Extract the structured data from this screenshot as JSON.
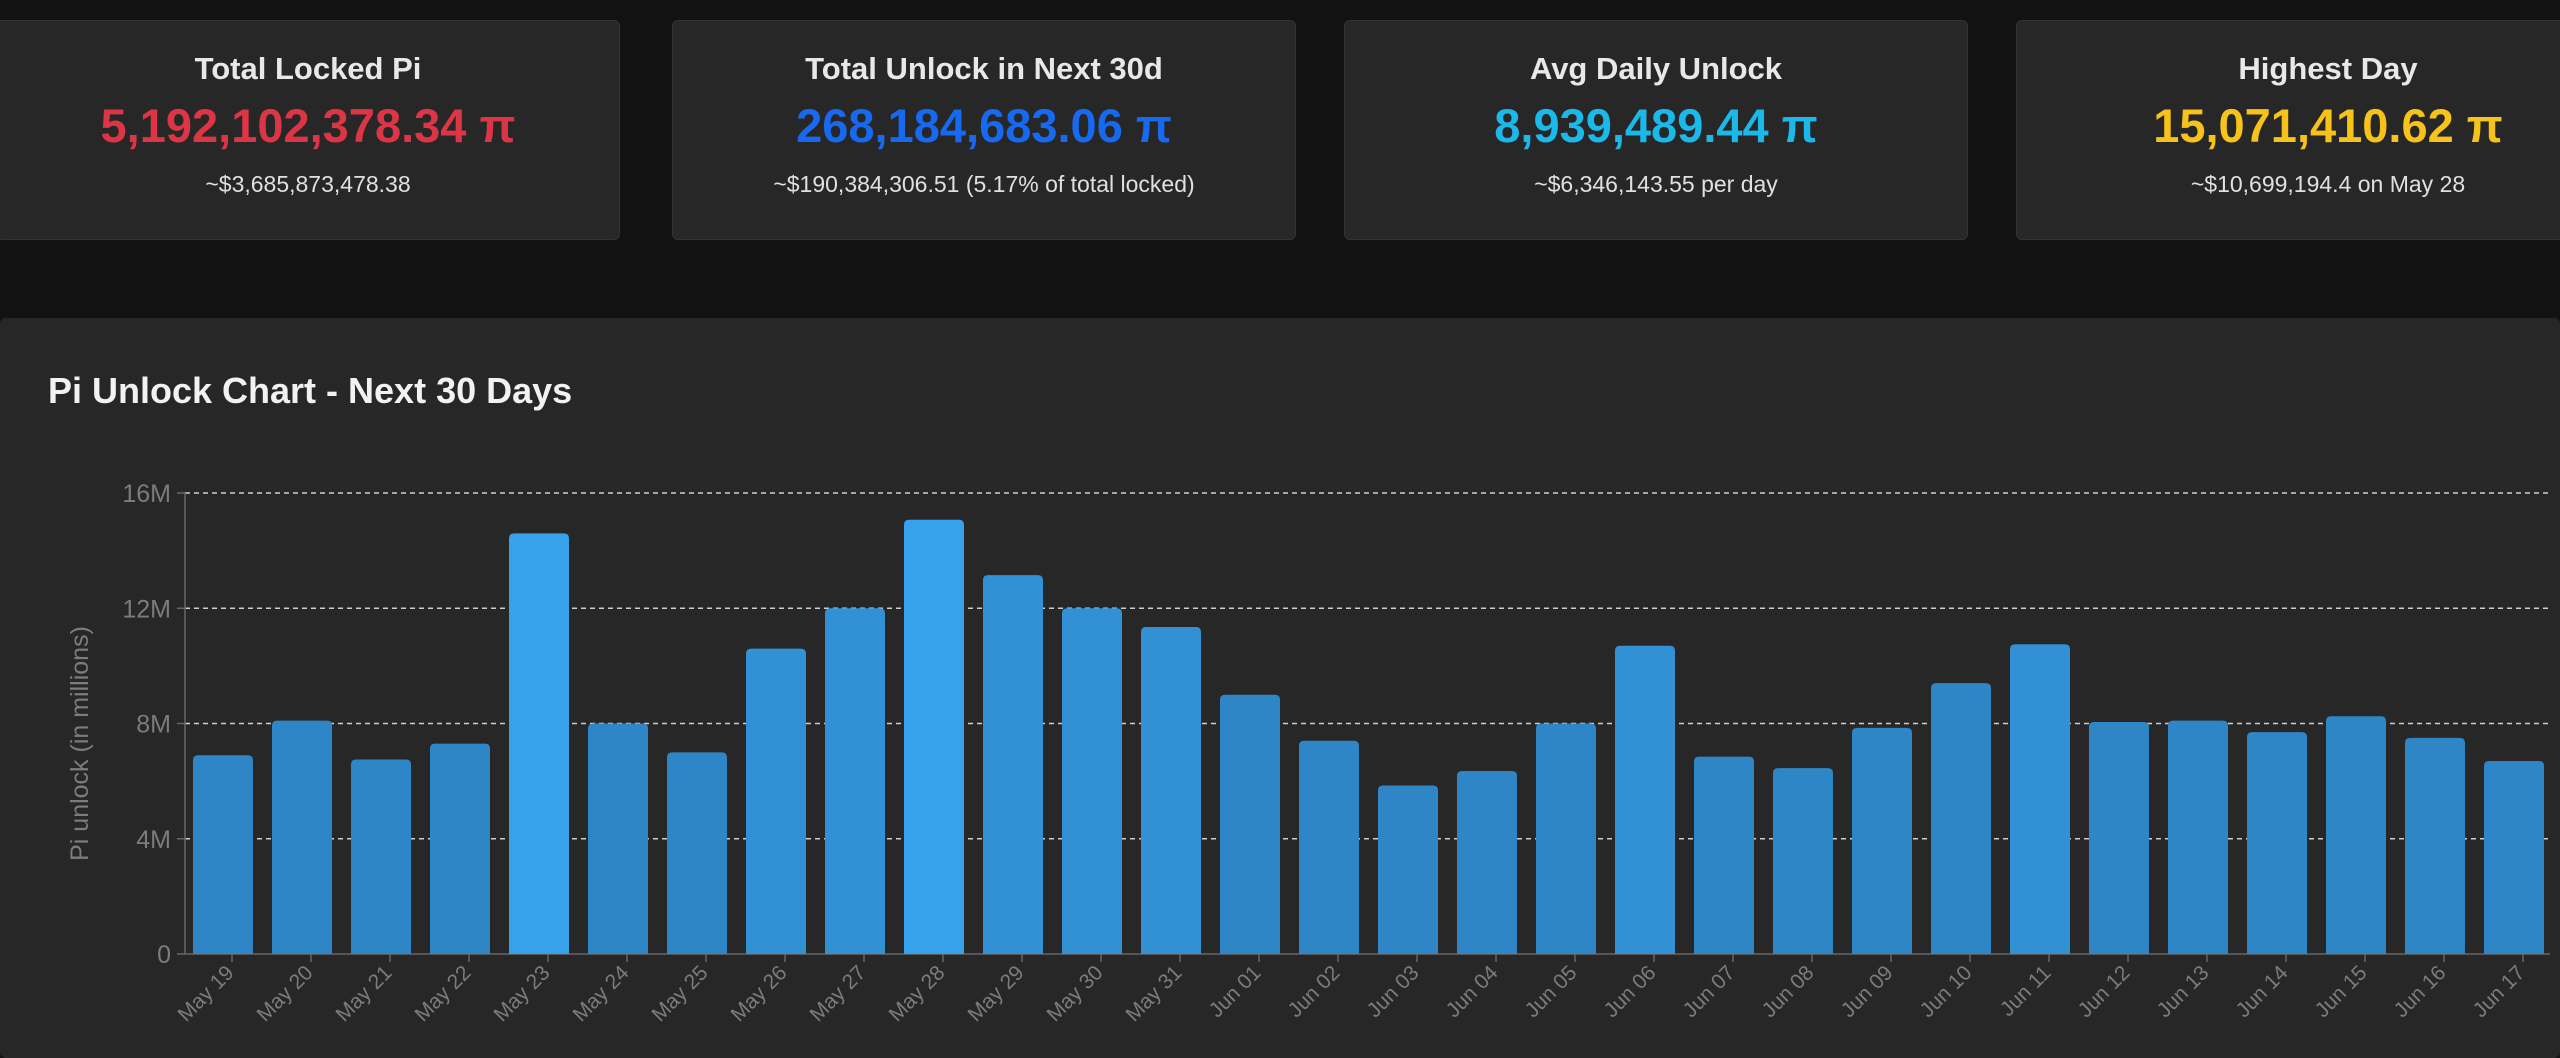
{
  "colors": {
    "background": "#121212",
    "card_bg": "#272727",
    "locked": "#dc3545",
    "unlock": "#1769f0",
    "avg": "#1bb8ea",
    "highest": "#f7c21a",
    "bar": "#2f86c6",
    "bar_highlight": "#36a2eb"
  },
  "cards": [
    {
      "title": "Total Locked Pi",
      "value": "5,192,102,378.34 π",
      "sub": "~$3,685,873,478.38",
      "color": "#dc3545"
    },
    {
      "title": "Total Unlock in Next 30d",
      "value": "268,184,683.06 π",
      "sub": "~$190,384,306.51 (5.17% of total locked)",
      "color": "#1769f0"
    },
    {
      "title": "Avg Daily Unlock",
      "value": "8,939,489.44 π",
      "sub": "~$6,346,143.55 per day",
      "color": "#1bb8ea"
    },
    {
      "title": "Highest Day",
      "value": "15,071,410.62 π",
      "sub": "~$10,699,194.4 on May 28",
      "color": "#f7c21a"
    }
  ],
  "panel": {
    "title": "Pi Unlock Chart - Next 30 Days"
  },
  "chart_data": {
    "type": "bar",
    "title": "Pi Unlock Chart - Next 30 Days",
    "xlabel": "",
    "ylabel": "Pi unlock (in millions)",
    "ylim": [
      0,
      16000000
    ],
    "yticks": [
      0,
      4000000,
      8000000,
      12000000,
      16000000
    ],
    "ytick_labels": [
      "0",
      "4M",
      "8M",
      "12M",
      "16M"
    ],
    "grid": true,
    "categories": [
      "May 19",
      "May 20",
      "May 21",
      "May 22",
      "May 23",
      "May 24",
      "May 25",
      "May 26",
      "May 27",
      "May 28",
      "May 29",
      "May 30",
      "May 31",
      "Jun 01",
      "Jun 02",
      "Jun 03",
      "Jun 04",
      "Jun 05",
      "Jun 06",
      "Jun 07",
      "Jun 08",
      "Jun 09",
      "Jun 10",
      "Jun 11",
      "Jun 12",
      "Jun 13",
      "Jun 14",
      "Jun 15",
      "Jun 16",
      "Jun 17"
    ],
    "values": [
      6900000,
      8100000,
      6750000,
      7300000,
      14600000,
      8000000,
      7000000,
      10600000,
      12000000,
      15071410.62,
      13150000,
      12000000,
      11350000,
      9000000,
      7400000,
      5850000,
      6350000,
      8000000,
      10700000,
      6850000,
      6450000,
      7850000,
      9400000,
      10750000,
      8050000,
      8100000,
      7700000,
      8250000,
      7500000,
      6700000
    ]
  }
}
